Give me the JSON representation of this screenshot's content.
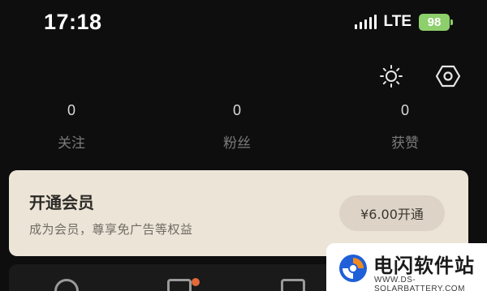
{
  "status_bar": {
    "time": "17:18",
    "network": "LTE",
    "battery": "98",
    "battery_color": "#8ccf6b"
  },
  "top_icons": [
    "brightness-icon",
    "settings-icon"
  ],
  "stats": [
    {
      "value": "0",
      "label": "关注"
    },
    {
      "value": "0",
      "label": "粉丝"
    },
    {
      "value": "0",
      "label": "获赞"
    }
  ],
  "vip": {
    "title": "开通会员",
    "subtitle": "成为会员，尊享免广告等权益",
    "button": "¥6.00开通",
    "card_color": "#ece4d7"
  },
  "watermark": {
    "title": "电闪软件站",
    "subtitle": "WWW.DS-SOLARBATTERY.COM"
  }
}
